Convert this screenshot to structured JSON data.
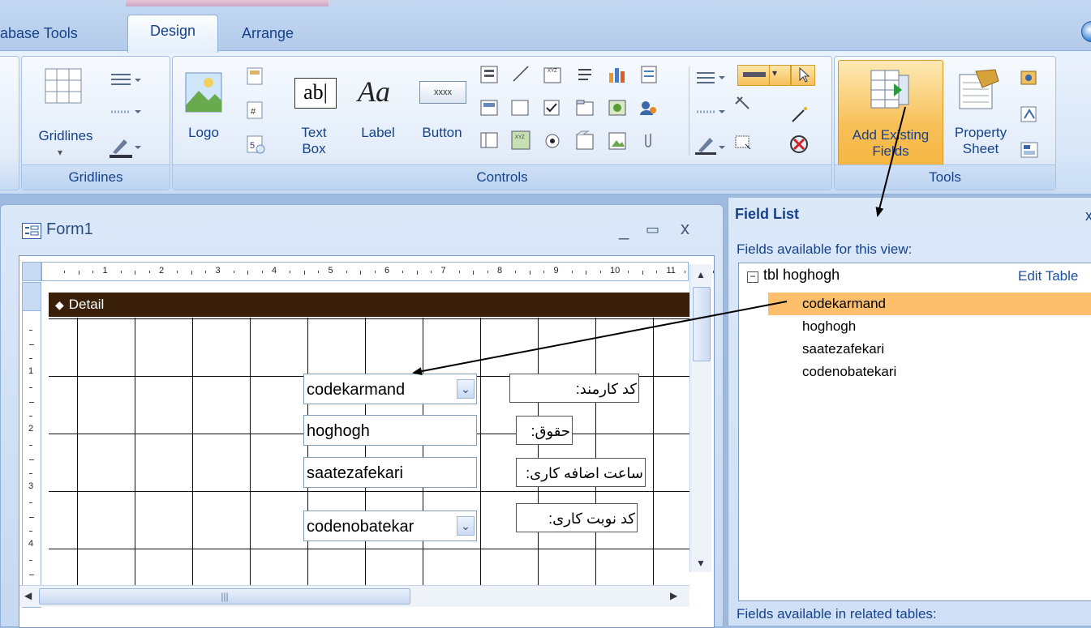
{
  "tabs": {
    "database_tools": "abase Tools",
    "design": "Design",
    "arrange": "Arrange"
  },
  "ribbon": {
    "gridlines": {
      "button_label": "Gridlines",
      "group_label": "Gridlines"
    },
    "controls": {
      "group_label": "Controls",
      "logo": "Logo",
      "text_box_line1": "Text",
      "text_box_line2": "Box",
      "label": "Label",
      "button": "Button",
      "button_icon_text": "xxxx",
      "text_box_icon_text": "ab|",
      "label_icon_text": "Aa"
    },
    "tools": {
      "group_label": "Tools",
      "add_existing_fields_line1": "Add Existing",
      "add_existing_fields_line2": "Fields",
      "property_sheet_line1": "Property",
      "property_sheet_line2": "Sheet"
    }
  },
  "form": {
    "title": "Form1",
    "detail_label": "Detail",
    "ruler_top": [
      "1",
      "2",
      "3",
      "4",
      "5",
      "6",
      "7",
      "8",
      "9",
      "10",
      "11"
    ],
    "ruler_left": [
      "1",
      "2",
      "3",
      "4"
    ],
    "controls": [
      {
        "name": "codekarmand",
        "label": "کد کارمند:",
        "combo": true
      },
      {
        "name": "hoghogh",
        "label": "حقوق:",
        "combo": false
      },
      {
        "name": "saatezafekari",
        "label": "ساعت اضافه کاری:",
        "combo": false
      },
      {
        "name": "codenobatekar",
        "label": "کد نوبت کاری:",
        "combo": true
      }
    ]
  },
  "field_list": {
    "title": "Field List",
    "close": "x",
    "fields_available": "Fields available for this view:",
    "table_name": "tbl hoghogh",
    "edit_table": "Edit Table",
    "fields": [
      "codekarmand",
      "hoghogh",
      "saatezafekari",
      "codenobatekari"
    ],
    "selected_field": "codekarmand",
    "related_tables": "Fields available in related tables:"
  },
  "colors": {
    "accent": "#15428b",
    "selection": "#fdbf6b",
    "detail_bar": "#3a1f09",
    "active_tool": "#f8c05a"
  }
}
